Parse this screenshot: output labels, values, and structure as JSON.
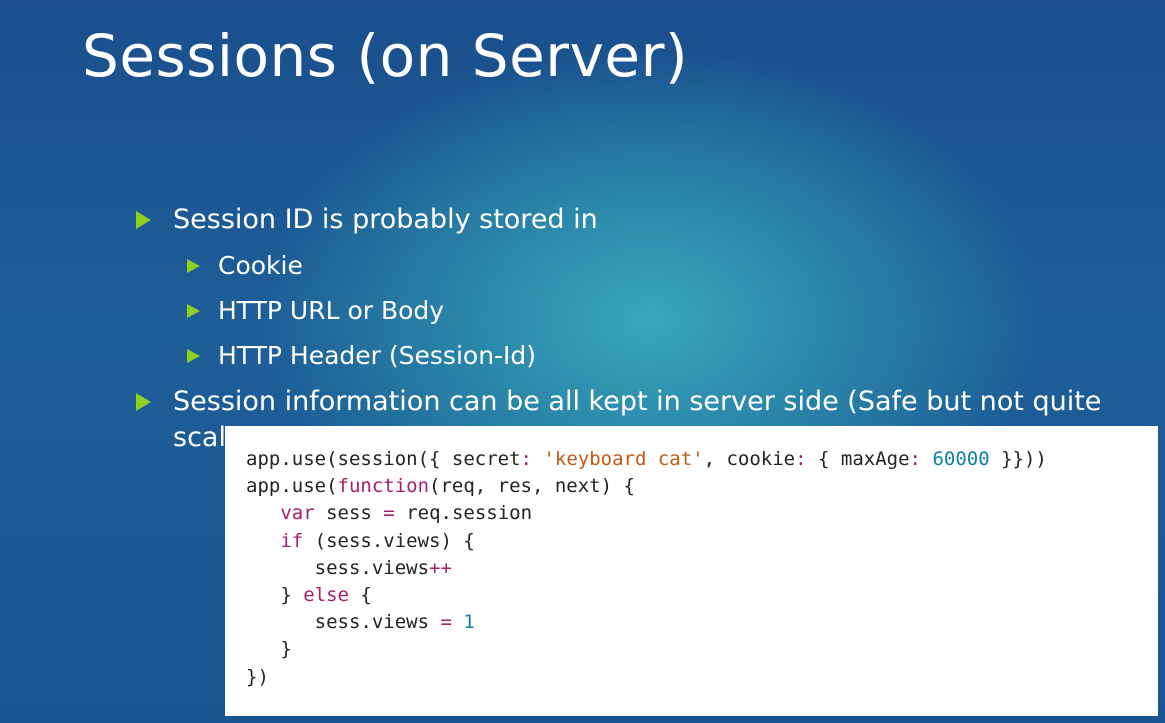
{
  "title": "Sessions (on Server)",
  "bullets": [
    {
      "text": "Session ID is probably stored in"
    },
    {
      "text": "Cookie"
    },
    {
      "text": "HTTP URL or Body"
    },
    {
      "text": "HTTP Header (Session-Id)"
    },
    {
      "text": "Session information can be all kept in server side (Safe but not quite"
    },
    {
      "text": "scal"
    }
  ],
  "code": {
    "line1": {
      "a": "app.use(session({ secret",
      "b": ":",
      "c": " ",
      "str": "'keyboard cat'",
      "d": ", cookie",
      "e": ":",
      "f": " { maxAge",
      "g": ":",
      "h": " ",
      "num": "60000",
      "i": " }}))"
    },
    "line2": {
      "a": "app.use(",
      "kw": "function",
      "b": "(req, res, next) {"
    },
    "line3": {
      "kw": "var",
      "a": " sess ",
      "op": "=",
      "b": " req.session"
    },
    "line4": {
      "kw": "if",
      "a": " (sess.views) {"
    },
    "line5": {
      "a": "sess.views",
      "op": "++"
    },
    "line6": {
      "a": "} ",
      "kw": "else",
      "b": " {"
    },
    "line7": {
      "a": "sess.views ",
      "op": "=",
      "b": " ",
      "num": "1"
    },
    "line8": {
      "a": "}"
    },
    "line9": {
      "a": "})"
    }
  },
  "colors": {
    "bullet_arrow": "#8fd11f",
    "keyword": "#a61d6d",
    "string": "#c45a16",
    "number": "#0e83a8"
  }
}
